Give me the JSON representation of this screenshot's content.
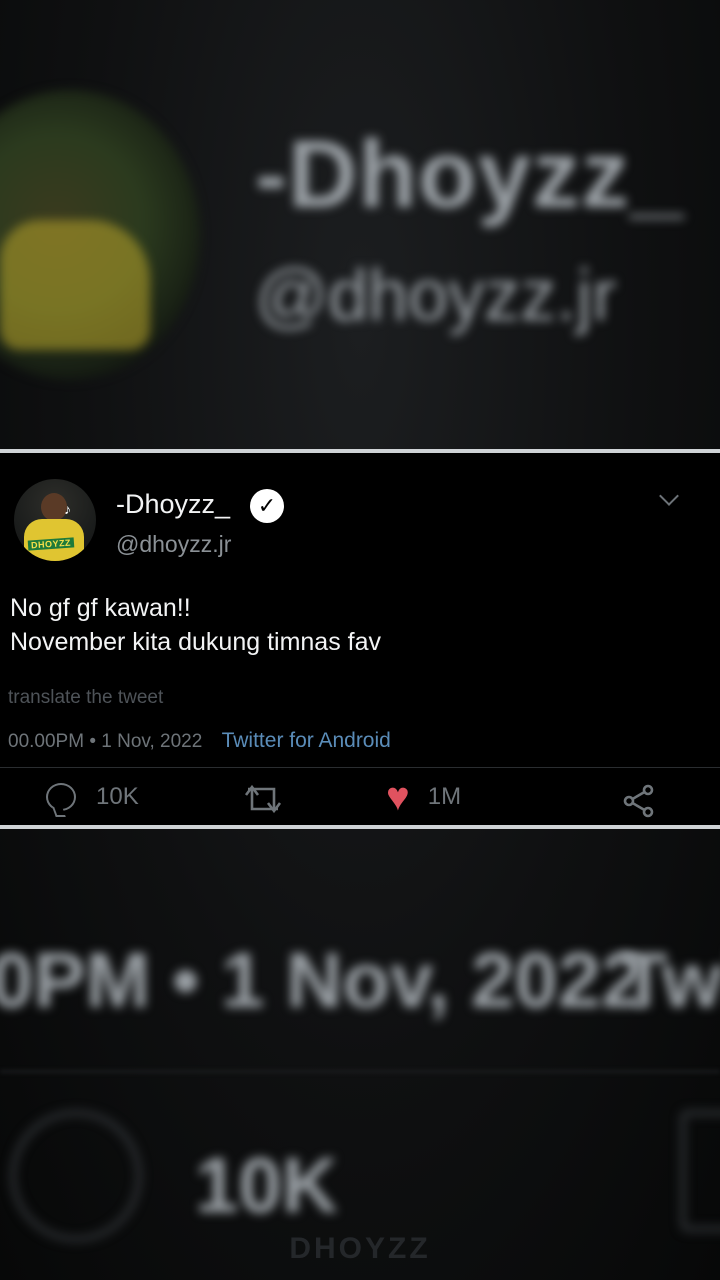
{
  "background": {
    "blurred_name": "-Dhoyzz_",
    "blurred_handle": "@dhoyzz.jr",
    "blurred_date": "0PM • 1 Nov, 2022",
    "blurred_source": "Twi",
    "blurred_count": "10K",
    "watermark": "DHOYZZ"
  },
  "tweet": {
    "display_name": "-Dhoyzz_",
    "verified_glyph": "✓",
    "handle": "@dhoyzz.jr",
    "avatar_tag": "DHOYZZ",
    "lines": [
      "No gf gf kawan!!",
      "November kita dukung timnas fav"
    ],
    "translate_label": "translate the tweet",
    "timestamp": "00.00PM • 1 Nov, 2022",
    "source": "Twitter for Android",
    "reply_count": "10K",
    "like_count": "1M"
  },
  "icons": {
    "reply": "comment-icon",
    "retweet": "retweet-icon",
    "like": "heart-icon",
    "share": "share-icon",
    "menu": "chevron-down-icon",
    "verified": "verified-badge-icon"
  },
  "colors": {
    "like": "#e0525f",
    "link": "#5a8cb8",
    "card_border": "#cfd3d6"
  }
}
